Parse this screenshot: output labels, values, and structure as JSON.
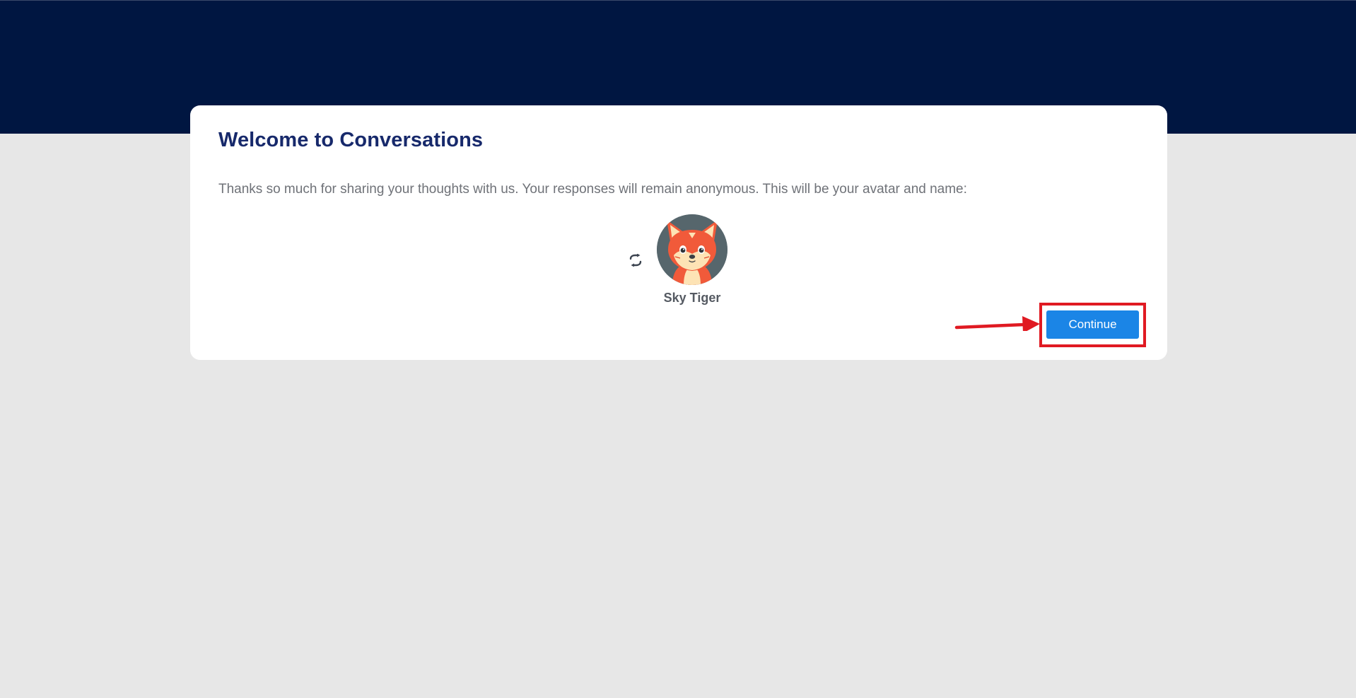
{
  "welcome_card": {
    "title": "Welcome to Conversations",
    "description": "Thanks so much for sharing your thoughts with us. Your responses will remain anonymous. This will be your avatar and name:",
    "avatar": {
      "name": "Sky Tiger",
      "icon": "fox-avatar",
      "refresh_icon": "refresh-icon"
    },
    "continue_label": "Continue"
  },
  "colors": {
    "header_band": "#001641",
    "page_background": "#e7e7e7",
    "title": "#17296b",
    "button": "#1b85e6",
    "annotation": "#e01a22"
  }
}
